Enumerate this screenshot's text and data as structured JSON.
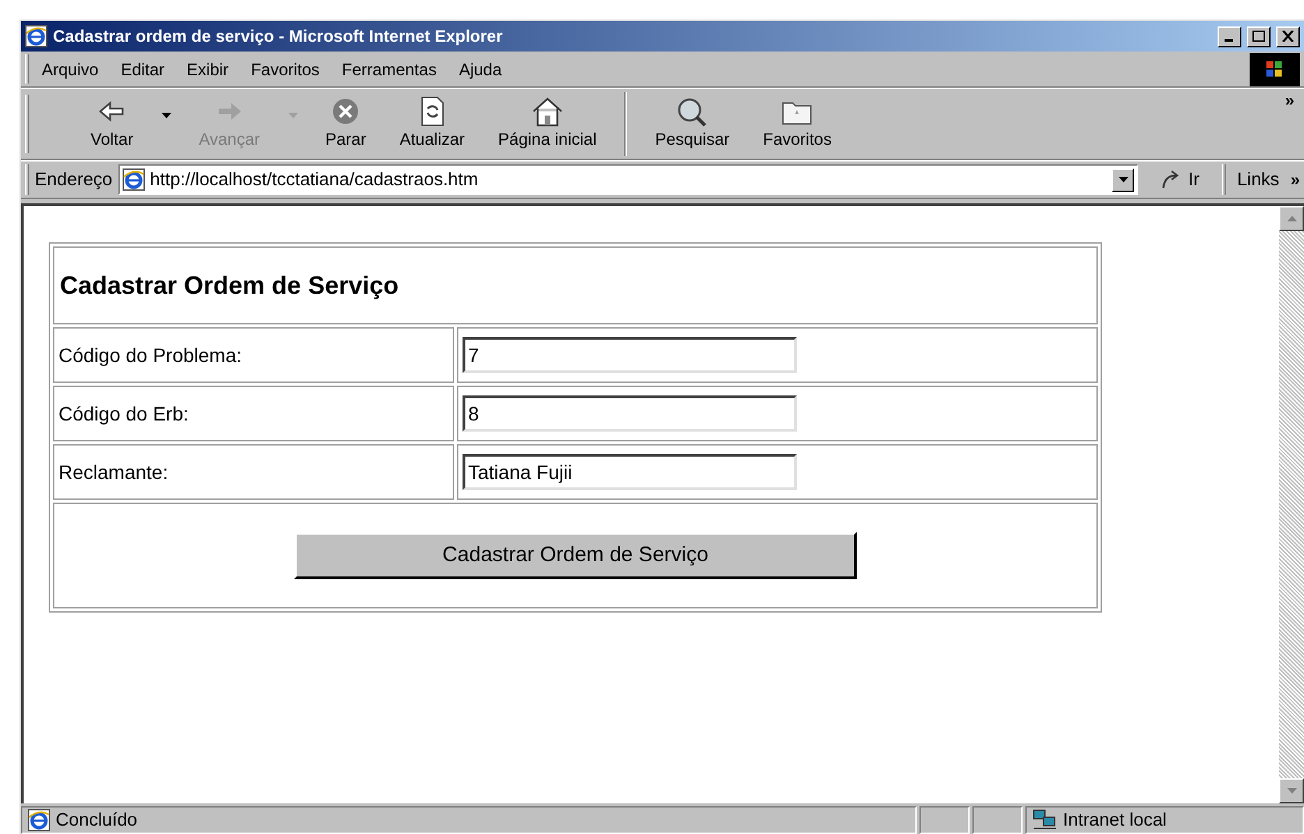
{
  "window": {
    "title": "Cadastrar ordem de serviço - Microsoft Internet Explorer"
  },
  "menu": [
    "Arquivo",
    "Editar",
    "Exibir",
    "Favoritos",
    "Ferramentas",
    "Ajuda"
  ],
  "toolbar": [
    {
      "label": "Voltar",
      "kind": "back",
      "disabled": false,
      "dropdown": true
    },
    {
      "label": "Avançar",
      "kind": "forward",
      "disabled": true,
      "dropdown": true
    },
    {
      "label": "Parar",
      "kind": "stop",
      "disabled": false,
      "dropdown": false
    },
    {
      "label": "Atualizar",
      "kind": "refresh",
      "disabled": false,
      "dropdown": false
    },
    {
      "label": "Página inicial",
      "kind": "home",
      "disabled": false,
      "dropdown": false
    },
    {
      "kind": "separator"
    },
    {
      "label": "Pesquisar",
      "kind": "search",
      "disabled": false,
      "dropdown": false
    },
    {
      "label": "Favoritos",
      "kind": "favorites",
      "disabled": false,
      "dropdown": false
    }
  ],
  "toolbar_more": "»",
  "address_bar": {
    "label": "Endereço",
    "url": "http://localhost/tcctatiana/cadastraos.htm",
    "go": "Ir",
    "links": "Links",
    "links_more": "»"
  },
  "form": {
    "heading": "Cadastrar Ordem de Serviço",
    "fields": [
      {
        "label": "Código do Problema:",
        "value": "7"
      },
      {
        "label": "Código do Erb:",
        "value": "8"
      },
      {
        "label": "Reclamante:",
        "value": "Tatiana Fujii"
      }
    ],
    "submit": "Cadastrar Ordem de Serviço"
  },
  "status_bar": {
    "text": "Concluído",
    "zone": "Intranet local"
  }
}
